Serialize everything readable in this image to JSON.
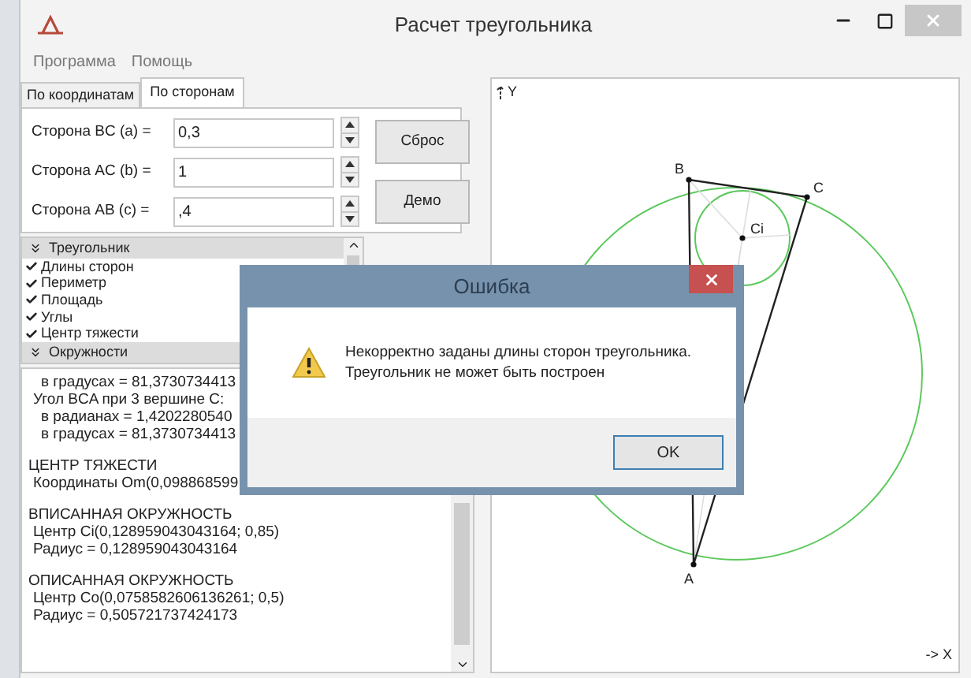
{
  "window": {
    "title": "Расчет треугольника"
  },
  "menu": [
    "Программа",
    "Помощь"
  ],
  "tabs": [
    {
      "label": "По координатам",
      "selected": false
    },
    {
      "label": "По сторонам",
      "selected": true
    }
  ],
  "fields": [
    {
      "label": "Сторона BC (a) =",
      "value": "0,3"
    },
    {
      "label": "Сторона AC (b) =",
      "value": "1"
    },
    {
      "label": "Сторона AB (c) =",
      "value": ",4"
    }
  ],
  "buttons": [
    "Сброс",
    "Демо"
  ],
  "sections": [
    {
      "title": "Треугольник",
      "items": [
        {
          "label": "Длины сторон",
          "checked": true
        },
        {
          "label": "Периметр",
          "checked": true
        },
        {
          "label": "Площадь",
          "checked": true
        },
        {
          "label": "Углы",
          "checked": true
        },
        {
          "label": "Центр тяжести",
          "checked": true
        }
      ]
    },
    {
      "title": "Окружности"
    }
  ],
  "output": [
    [
      {
        "kind": "sub",
        "text": "в градусах = 81,3730734413"
      },
      {
        "kind": "item",
        "text": "Угол BCA при 3 вершине C:"
      },
      {
        "kind": "sub",
        "text": "в радианах = 1,4202280540"
      },
      {
        "kind": "sub",
        "text": "в градусах = 81,3730734413"
      }
    ],
    [
      {
        "kind": "heading",
        "text": "ЦЕНТР ТЯЖЕСТИ"
      },
      {
        "kind": "item",
        "text": "Координаты Om(0,098868599"
      }
    ],
    [
      {
        "kind": "heading",
        "text": "ВПИСАННАЯ ОКРУЖНОСТЬ"
      },
      {
        "kind": "item",
        "text": "Центр Ci(0,128959043043164; 0,85)"
      },
      {
        "kind": "item",
        "text": "Радиус = 0,128959043043164"
      }
    ],
    [
      {
        "kind": "heading",
        "text": "ОПИСАННАЯ ОКРУЖНОСТЬ"
      },
      {
        "kind": "item",
        "text": "Центр Co(0,0758582606136261; 0,5)"
      },
      {
        "kind": "item",
        "text": "Радиус = 0,505721737424173"
      }
    ]
  ],
  "canvas": {
    "y_axis": "Y",
    "x_axis": "-> X",
    "points": [
      "B",
      "C",
      "Ci",
      "A"
    ]
  },
  "dialog": {
    "title": "Ошибка",
    "message": [
      "Некорректно заданы длины сторон треугольника.",
      "Треугольник не может быть построен"
    ],
    "button": "OK"
  }
}
